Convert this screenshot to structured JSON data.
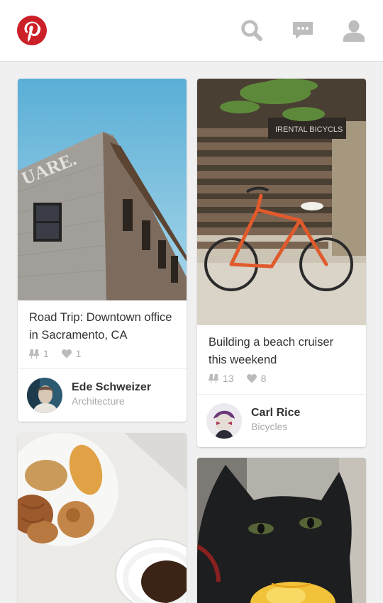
{
  "header": {
    "logo": "pinterest-logo",
    "icons": [
      "search-icon",
      "messages-icon",
      "profile-icon"
    ]
  },
  "pins": [
    {
      "description": "Road Trip: Downtown office in Sacramento, CA",
      "repins": "1",
      "likes": "1",
      "owner": "Ede Schweizer",
      "board": "Architecture"
    },
    {
      "description": "Building a beach cruiser this weekend",
      "repins": "13",
      "likes": "8",
      "owner": "Carl Rice",
      "board": "Bicycles"
    },
    {
      "description": "",
      "image": "pastries-coffee-photo"
    },
    {
      "description": "",
      "image": "black-cat-photo"
    }
  ],
  "colors": {
    "brand": "#cb2027",
    "icon_gray": "#bdbdbd",
    "background": "#f0f0f0"
  }
}
